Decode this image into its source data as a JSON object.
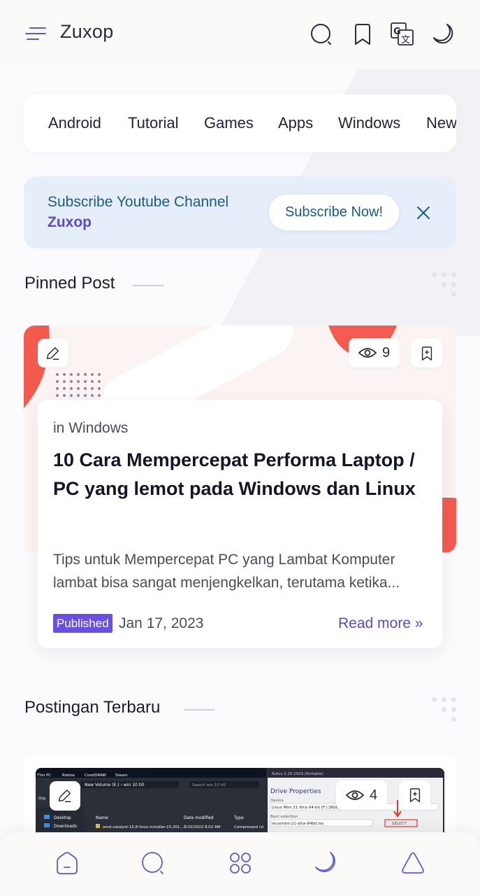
{
  "header": {
    "brand": "Zuxop"
  },
  "categories": [
    "Android",
    "Tutorial",
    "Games",
    "Apps",
    "Windows",
    "New"
  ],
  "subscribe": {
    "line1": "Subscribe Youtube Channel",
    "line2": "Zuxop",
    "button": "Subscribe Now!"
  },
  "pinned": {
    "section_title": "Pinned Post",
    "views": "9",
    "category_prefix": "in",
    "category": "Windows",
    "title": "10 Cara Mempercepat Performa Laptop / PC yang lemot pada Windows dan Linux",
    "excerpt_line1": "Tips untuk Mempercepat PC yang Lambat Komputer",
    "excerpt_line2": "lambat bisa sangat menjengkelkan, terutama ketika...",
    "status": "Published",
    "date": "Jan 17, 2023",
    "read_more": "Read more »"
  },
  "recent": {
    "section_title": "Postingan Terbaru",
    "views": "4",
    "screenshot_texts": {
      "desktop_icons": [
        "This PC",
        "Roblox",
        "CorelDRAW",
        "Steam"
      ],
      "path": "New Volume (E:) › win 10 ti0",
      "search": "Search win 10 ti0",
      "col_name": "Name",
      "col_date": "Date modified",
      "col_type": "Type",
      "sidebar": [
        "Desktop",
        "Downloads"
      ],
      "org": "Org",
      "folder": "folder",
      "file_name": "amd-catalyst-15.8-linux-installer-15.201...",
      "file_date": "8/10/2022 8:02 AM",
      "file_type": "Compressed (zi",
      "rufus_title": "Rufus 3.20.1929 (Portable)",
      "drive_properties": "Drive Properties",
      "device_label": "Device",
      "device_value": "Linux Mint 21 Xfce 64-bit (F:) [8GB]",
      "boot_label": "Boot selection",
      "boot_value": "linuxmint-21-xfce-64bit.iso",
      "select": "SELECT"
    }
  },
  "colors": {
    "accent": "#5b48d8",
    "subscribe_bg": "#e6eefa",
    "subscribe_text": "#1b5c86",
    "published_badge": "#6a4fe4",
    "coral": "#f55a4e"
  },
  "icons": {
    "header": [
      "menu-icon",
      "search-icon",
      "bookmark-icon",
      "translate-icon",
      "moon-icon"
    ],
    "bottom_nav": [
      "home-icon",
      "search-icon",
      "grid-icon",
      "moon-icon",
      "triangle-icon"
    ]
  }
}
